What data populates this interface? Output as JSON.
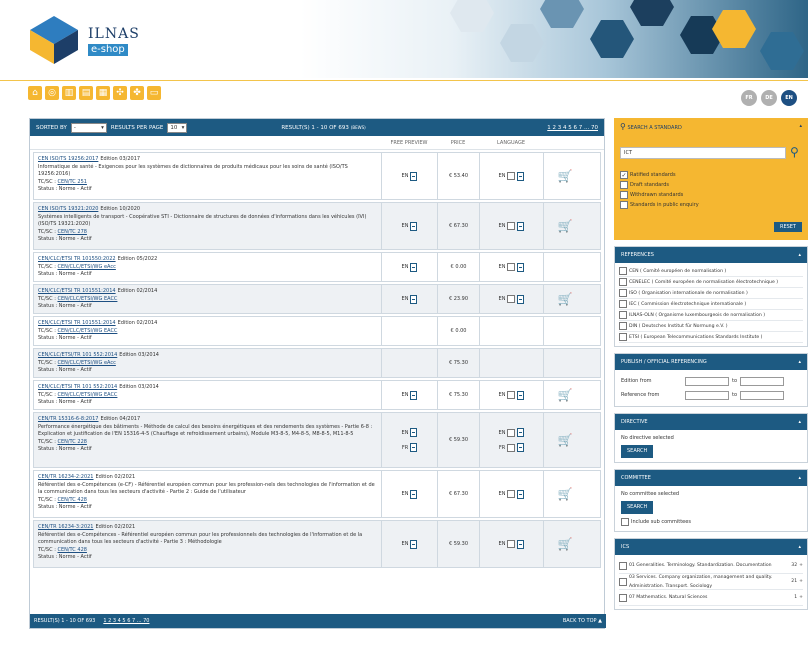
{
  "header": {
    "logo_name": "ILNAS",
    "logo_sub": "e-shop"
  },
  "languages": [
    "FR",
    "DE",
    "EN"
  ],
  "results": {
    "sorted_by_label": "SORTED BY",
    "sorted_value": "-",
    "per_page_label": "RESULTS PER PAGE",
    "per_page_value": "10",
    "count": "RESULT(S) 1 - 10 OF 693",
    "count_suffix": "(BEWS)",
    "pages": "1 2 3 4 5 6 7 ... 70",
    "col_preview": "FREE PREVIEW",
    "col_price": "PRICE",
    "col_language": "LANGUAGE",
    "footer_count": "RESULT(S) 1 - 10 OF 693",
    "footer_pages": "1 2 3 4 5 6 7 ... 70",
    "back_to_top": "BACK TO TOP ▲",
    "rows": [
      {
        "ref": "CEN ISO/TS 19256:2017",
        "edition": "Edition 03/2017",
        "desc": "Informatique de santé - Exigences pour les systèmes de dictionnaires de produits médicaux pour les soins de santé (ISO/TS 19256:2016)",
        "tc": "CEN/TC 251",
        "status": "Status : Norme - Actif",
        "preview": [
          "EN"
        ],
        "price": "€ 53.40",
        "langs": [
          "EN"
        ],
        "cart": true
      },
      {
        "ref": "CEN ISO/TS 19321:2020",
        "edition": "Edition 10/2020",
        "desc": "Systèmes intelligents de transport - Coopérative STI - Dictionnaire de structures de données d'informations dans les véhicules (IVI) (ISO/TS 19321:2020)",
        "tc": "CEN/TC 278",
        "status": "Status : Norme - Actif",
        "preview": [
          "EN"
        ],
        "price": "€ 67.30",
        "langs": [
          "EN"
        ],
        "cart": true
      },
      {
        "ref": "CEN/CLC/ETSI TR 101550:2022",
        "edition": "Edition 05/2022",
        "desc": "",
        "tc": "CEN/CLC/ETSI/WG eAcc",
        "status": "Status : Norme - Actif",
        "preview": [
          "EN"
        ],
        "price": "€ 0.00",
        "langs": [
          "EN"
        ],
        "cart": false
      },
      {
        "ref": "CEN/CLC/ETSI TR 101551:2014",
        "edition": "Edition 02/2014",
        "desc": "",
        "tc": "CEN/CLC/ETSI/WG EACC",
        "status": "Status : Norme - Actif",
        "preview": [
          "EN"
        ],
        "price": "€ 23.90",
        "langs": [
          "EN"
        ],
        "cart": true
      },
      {
        "ref": "CEN/CLC/ETSI TR 101551:2014",
        "edition": "Edition 02/2014",
        "desc": "",
        "tc": "CEN/CLC/ETSI/WG EACC",
        "status": "Status : Norme - Actif",
        "preview": [],
        "price": "€ 0.00",
        "langs": [],
        "cart": false
      },
      {
        "ref": "CEN/CLC/ETSI/TR 101 552:2014",
        "edition": "Edition 03/2014",
        "desc": "",
        "tc": "CEN/CLC/ETSI/WG eAcc",
        "status": "Status : Norme - Actif",
        "preview": [],
        "price": "€ 75.30",
        "langs": [],
        "cart": false
      },
      {
        "ref": "CEN/CLC/ETSI TR 101 552:2014",
        "edition": "Edition 03/2014",
        "desc": "",
        "tc": "CEN/CLC/ETSI/WG EACC",
        "status": "Status : Norme - Actif",
        "preview": [
          "EN"
        ],
        "price": "€ 75.30",
        "langs": [
          "EN"
        ],
        "cart": true
      },
      {
        "ref": "CEN/TR 15316-6-8:2017",
        "edition": "Edition 04/2017",
        "desc": "Performance énergétique des bâtiments - Méthode de calcul des besoins énergétiques et des rendements des systèmes - Partie 6-8 : Explication et justification de l'EN 15316-4-5 (Chauffage et refroidissement urbains), Module M3-8-5, M4-8-5, M8-8-5, M11-8-5",
        "tc": "CEN/TC 228",
        "status": "Status : Norme - Actif",
        "preview": [
          "EN",
          "FR"
        ],
        "price": "€ 59.30",
        "langs": [
          "EN",
          "FR"
        ],
        "cart": true
      },
      {
        "ref": "CEN/TR 16234-2:2021",
        "edition": "Edition 02/2021",
        "desc": "Référentiel des e-Compétences (e-CF) - Référentiel européen commun pour les profession-nels des technologies de l'information et de la communication dans tous les secteurs d'activité - Partie 2 : Guide de l'utilisateur",
        "tc": "CEN/TC 428",
        "status": "Status : Norme - Actif",
        "preview": [
          "EN"
        ],
        "price": "€ 67.30",
        "langs": [
          "EN"
        ],
        "cart": true
      },
      {
        "ref": "CEN/TR 16234-3:2021",
        "edition": "Edition 02/2021",
        "desc": "Référentiel des e-Compétences - Référentiel européen commun pour les professionnels des technologies de l'information et de la communication dans tous les secteurs d'activité - Partie 3 : Méthodologie",
        "tc": "CEN/TC 428",
        "status": "Status : Norme - Actif",
        "preview": [
          "EN"
        ],
        "price": "€ 59.30",
        "langs": [
          "EN"
        ],
        "cart": true
      }
    ]
  },
  "sidebar": {
    "search_title": "SEARCH A STANDARD",
    "search_value": "ICT",
    "search_options": [
      {
        "label": "Ratified standards",
        "checked": true
      },
      {
        "label": "Draft standards",
        "checked": false
      },
      {
        "label": "Withdrawn standards",
        "checked": false
      },
      {
        "label": "Standards in public enquiry",
        "checked": false
      }
    ],
    "reset": "RESET",
    "references_title": "REFERENCES",
    "references": [
      "CEN ( Comité européen de normalisation )",
      "CENELEC ( Comité européen de normalisation électrotechnique )",
      "ISO ( Organisation internationale de normalisation )",
      "IEC ( Commission électrotechnique internationale )",
      "ILNAS-OLN ( Organisme luxembourgeois de normalisation )",
      "DIN ( Deutsches Institut für Normung e.V. )",
      "ETSI ( European Telecommunications Standards Institute )"
    ],
    "publish_title": "PUBLISH / OFFICIAL REFERENCING",
    "edition_from": "Edition from",
    "reference_from": "Reference from",
    "to": "to",
    "directive_title": "DIRECTIVE",
    "directive_none": "No directive selected",
    "search_btn": "SEARCH",
    "committee_title": "COMMITTEE",
    "committee_none": "No committee selected",
    "include_sub": "Include sub committees",
    "ics_title": "ICS",
    "ics": [
      {
        "label": "01 Generalities. Terminology. Standardization. Documentation",
        "count": "32"
      },
      {
        "label": "03 Services. Company organization, management and quality. Administration. Transport. Sociology",
        "count": "21"
      },
      {
        "label": "07 Mathematics. Natural Sciences",
        "count": "1"
      }
    ]
  }
}
